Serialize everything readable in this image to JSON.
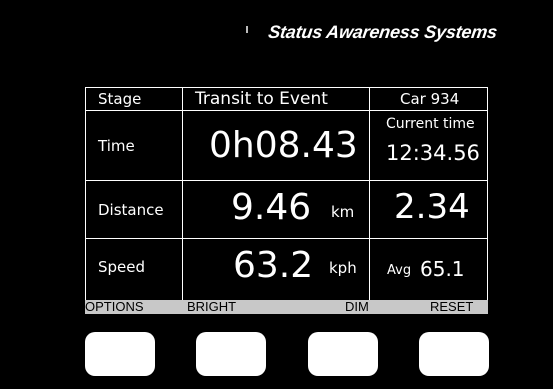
{
  "brand": "Status Awareness Systems",
  "header": {
    "stage_label": "Stage",
    "stage_value": "Transit to Event",
    "car": "Car 934"
  },
  "rows": {
    "time": {
      "label": "Time",
      "value": "0h08.43",
      "right_label": "Current time",
      "right_value": "12:34.56"
    },
    "distance": {
      "label": "Distance",
      "value": "9.46",
      "unit": "km",
      "right_value": "2.34"
    },
    "speed": {
      "label": "Speed",
      "value": "63.2",
      "unit": "kph",
      "avg_label": "Avg",
      "avg_value": "65.1"
    }
  },
  "softkeys": {
    "options": "OPTIONS",
    "bright": "BRIGHT",
    "dim": "DIM",
    "reset": "RESET"
  },
  "colors": {
    "background": "#000000",
    "text": "#ffffff",
    "softkey_bar": "#c8c8c8",
    "softkey_button": "#ffffff"
  }
}
